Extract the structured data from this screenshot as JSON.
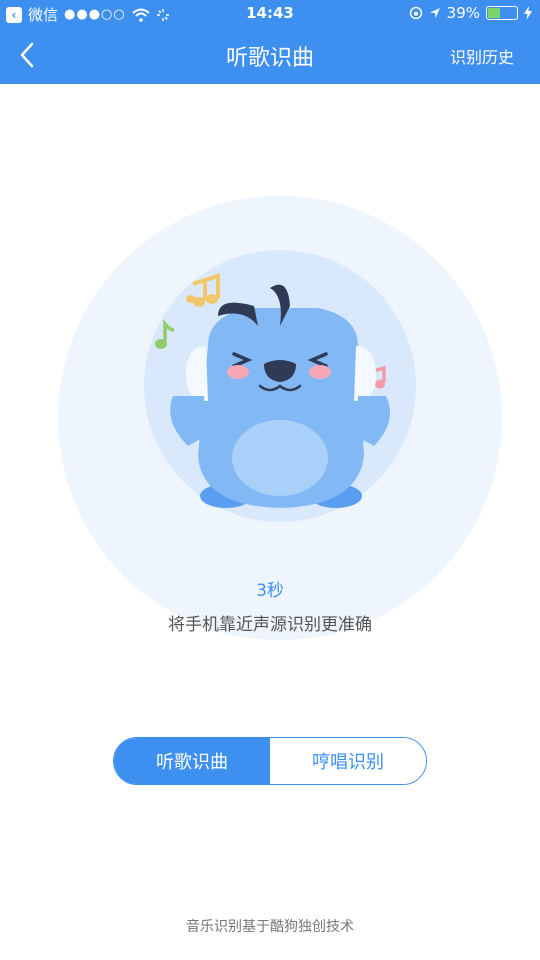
{
  "status_bar": {
    "carrier": "微信",
    "signal": "●●●○○",
    "time": "14:43",
    "battery_percent": "39%",
    "battery_level": 0.39
  },
  "nav": {
    "title": "听歌识曲",
    "history_label": "识别历史"
  },
  "main": {
    "countdown": "3秒",
    "hint": "将手机靠近声源识别更准确"
  },
  "tabs": [
    {
      "label": "听歌识曲",
      "active": true
    },
    {
      "label": "哼唱识别",
      "active": false
    }
  ],
  "footer": {
    "text": "音乐识别基于酷狗独创技术"
  },
  "colors": {
    "accent": "#3d8ff0",
    "circle_outer": "#eef5fd",
    "circle_inner": "#d9e9fb",
    "mascot": "#82b9f5"
  }
}
